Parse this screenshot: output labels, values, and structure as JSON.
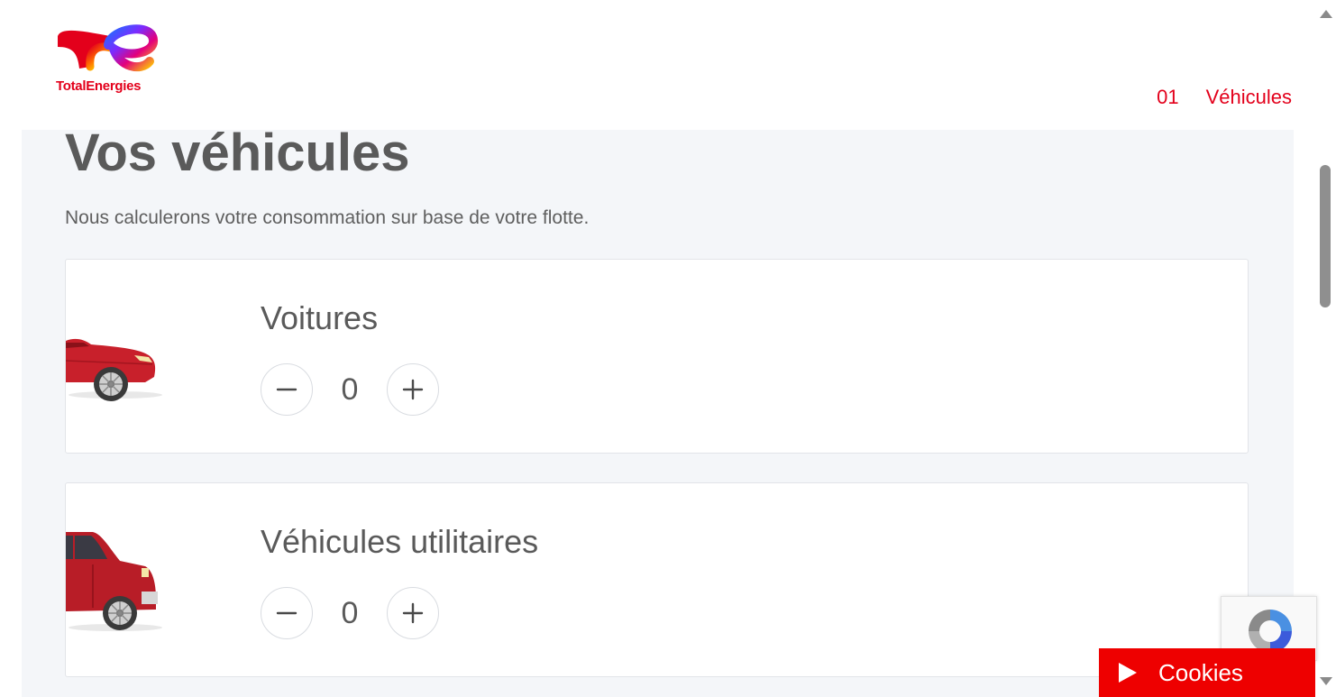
{
  "header": {
    "logo_text": "TotalEnergies",
    "step_number": "01",
    "step_label": "Véhicules"
  },
  "main": {
    "title": "Vos véhicules",
    "subtitle": "Nous calculerons votre consommation sur base de votre flotte."
  },
  "cards": [
    {
      "label": "Voitures",
      "count": "0",
      "image_icon": "red-car-icon"
    },
    {
      "label": "Véhicules utilitaires",
      "count": "0",
      "image_icon": "red-van-icon"
    }
  ],
  "stepper_icons": {
    "decrement": "minus-icon",
    "increment": "plus-icon"
  },
  "cookies": {
    "label": "Cookies",
    "icon": "play-icon"
  },
  "colors": {
    "brand_red": "#e3001b",
    "cookies_red": "#ee0000",
    "background": "#f4f6f9",
    "text": "#5a5a5a"
  }
}
